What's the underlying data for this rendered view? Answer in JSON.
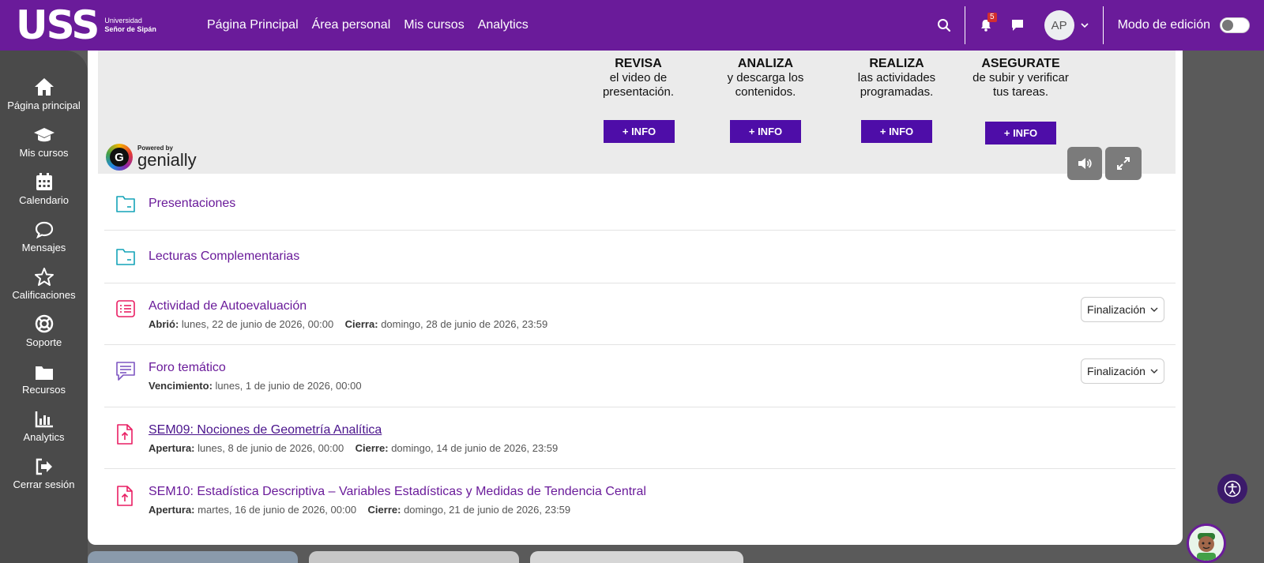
{
  "brand": {
    "mark": "USS",
    "line1": "Universidad",
    "line2": "Señor de Sipán"
  },
  "nav": {
    "links": [
      "Página Principal",
      "Área personal",
      "Mis cursos",
      "Analytics"
    ]
  },
  "header": {
    "notification_count": "5",
    "avatar_initials": "AP",
    "edit_mode_label": "Modo de edición"
  },
  "sidebar": {
    "items": [
      {
        "label": "Página principal",
        "icon": "home-icon"
      },
      {
        "label": "Mis cursos",
        "icon": "graduation-cap-icon"
      },
      {
        "label": "Calendario",
        "icon": "calendar-icon"
      },
      {
        "label": "Mensajes",
        "icon": "message-icon"
      },
      {
        "label": "Calificaciones",
        "icon": "star-icon"
      },
      {
        "label": "Soporte",
        "icon": "lifebuoy-icon"
      },
      {
        "label": "Recursos",
        "icon": "folder-icon"
      },
      {
        "label": "Analytics",
        "icon": "bar-chart-icon"
      },
      {
        "label": "Cerrar sesión",
        "icon": "logout-icon"
      }
    ]
  },
  "genially": {
    "steps": [
      {
        "head": "REVISA",
        "line1": "el video de",
        "line2": "presentación.",
        "button": "+ INFO"
      },
      {
        "head": "ANALIZA",
        "line1": "y descarga los",
        "line2": "contenidos.",
        "button": "+ INFO"
      },
      {
        "head": "REALIZA",
        "line1": "las actividades",
        "line2": "programadas.",
        "button": "+ INFO"
      },
      {
        "head": "ASEGURATE",
        "line1": "de subir y verificar",
        "line2": "tus tareas.",
        "button": "+ INFO"
      }
    ],
    "powered_by": "Powered by",
    "brand": "genially"
  },
  "activities": [
    {
      "title": "Presentaciones",
      "type": "folder"
    },
    {
      "title": "Lecturas Complementarias",
      "type": "folder"
    },
    {
      "title": "Actividad de Autoevaluación",
      "type": "quiz",
      "meta1_label": "Abrió:",
      "meta1_value": "lunes, 22 de junio de 2026, 00:00",
      "meta2_label": "Cierra:",
      "meta2_value": "domingo, 28 de junio de 2026, 23:59",
      "completion": "Finalización"
    },
    {
      "title": "Foro temático",
      "type": "forum",
      "meta1_label": "Vencimiento:",
      "meta1_value": "lunes, 1 de junio de 2026, 00:00",
      "completion": "Finalización"
    },
    {
      "title": "SEM09: Nociones de Geometría Analítica",
      "type": "assignment",
      "meta1_label": "Apertura:",
      "meta1_value": "lunes, 8 de junio de 2026, 00:00",
      "meta2_label": "Cierre:",
      "meta2_value": "domingo, 14 de junio de 2026, 23:59"
    },
    {
      "title": "SEM10: Estadística Descriptiva – Variables Estadísticas y Medidas de Tendencia Central",
      "type": "assignment",
      "meta1_label": "Apertura:",
      "meta1_value": "martes, 16 de junio de 2026, 00:00",
      "meta2_label": "Cierre:",
      "meta2_value": "domingo, 21 de junio de 2026, 23:59"
    }
  ],
  "colors": {
    "brand_purple": "#6a1b9a",
    "info_button": "#4e0da8",
    "sidebar": "#4a4a4a"
  }
}
